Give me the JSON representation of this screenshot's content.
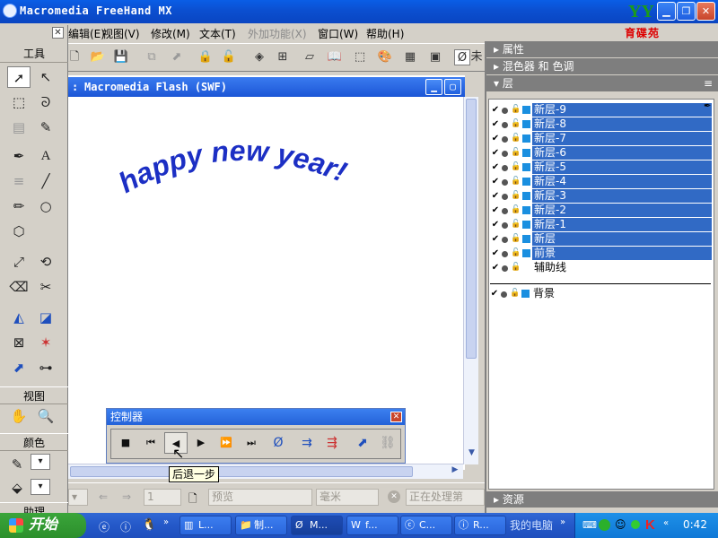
{
  "app": {
    "title": "Macromedia FreeHand MX",
    "logo_text": "育碟苑"
  },
  "menu": {
    "items": [
      "编辑(E)",
      "视图(V)",
      "修改(M)",
      "文本(T)",
      "外加功能(X)",
      "窗口(W)",
      "帮助(H)"
    ],
    "disabled_index": 4
  },
  "tools": {
    "title": "工具",
    "sections": [
      "视图",
      "颜色",
      "助理"
    ]
  },
  "document": {
    "title": "Macromedia Flash (SWF)",
    "title_prefix": ": ",
    "content_text": "happy new year!",
    "text_color": "#1c2fc4",
    "toolbar_tail": "未"
  },
  "controller": {
    "title": "控制器",
    "tooltip": "后退一步"
  },
  "status": {
    "page_value": "1",
    "view_mode": "预览",
    "units": "毫米",
    "progress_text": "正在处理第"
  },
  "right_panel": {
    "sections": [
      "属性",
      "混色器 和 色调",
      "层"
    ],
    "bottom_section": "资源"
  },
  "layers": {
    "items": [
      {
        "name": "新层-9",
        "selected": true
      },
      {
        "name": "新层-8",
        "selected": true
      },
      {
        "name": "新层-7",
        "selected": true
      },
      {
        "name": "新层-6",
        "selected": true
      },
      {
        "name": "新层-5",
        "selected": true
      },
      {
        "name": "新层-4",
        "selected": true
      },
      {
        "name": "新层-3",
        "selected": true
      },
      {
        "name": "新层-2",
        "selected": true
      },
      {
        "name": "新层-1",
        "selected": true
      },
      {
        "name": "新层",
        "selected": true
      },
      {
        "name": "前景",
        "selected": true
      },
      {
        "name": "辅助线",
        "selected": false
      }
    ],
    "background_layer": "背景",
    "swatch_color": "#1a8fe0",
    "selection_color": "#316ac5"
  },
  "taskbar": {
    "start_label": "开始",
    "tasks": [
      "L...",
      "制...",
      "M...",
      "f...",
      "C...",
      "R..."
    ],
    "active_index": 2,
    "mycomputer": "我的电脑",
    "clock": "0:42"
  },
  "colors": {
    "xp_blue": "#0a5ee6",
    "panel_gray": "#d4d0c8",
    "taskbar_blue": "#2458c8"
  }
}
